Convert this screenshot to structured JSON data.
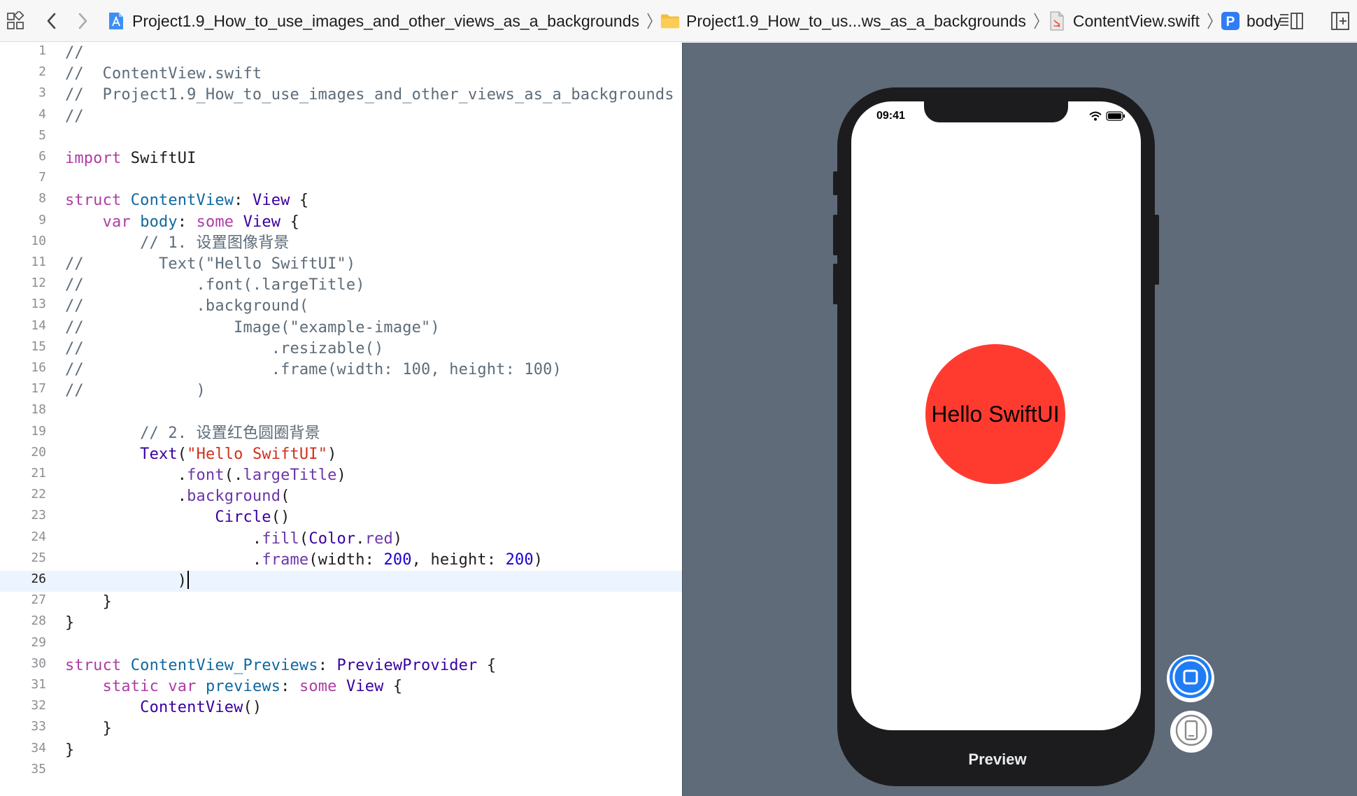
{
  "jumpbar": {
    "grid_icon": "related-items-grid-icon",
    "back_icon": "chevron-left-icon",
    "forward_icon": "chevron-right-icon",
    "crumbs": [
      {
        "label": "Project1.9_How_to_use_images_and_other_views_as_a_backgrounds",
        "icon": "xcode-project-icon"
      },
      {
        "label": "Project1.9_How_to_us...ws_as_a_backgrounds",
        "icon": "folder-icon"
      },
      {
        "label": "ContentView.swift",
        "icon": "swift-file-icon"
      },
      {
        "label": "body",
        "icon": "property-p-icon",
        "icon_letter": "P"
      }
    ],
    "editor_options_icon": "editor-options-icon",
    "add_editor_icon": "add-editor-split-icon"
  },
  "editor": {
    "current_line": 26,
    "lines": [
      {
        "n": "1",
        "tokens": [
          {
            "t": "//",
            "c": "com"
          }
        ]
      },
      {
        "n": "2",
        "tokens": [
          {
            "t": "//  ContentView.swift",
            "c": "com"
          }
        ]
      },
      {
        "n": "3",
        "tokens": [
          {
            "t": "//  Project1.9_How_to_use_images_and_other_views_as_a_backgrounds",
            "c": "com"
          }
        ]
      },
      {
        "n": "4",
        "tokens": [
          {
            "t": "//",
            "c": "com"
          }
        ]
      },
      {
        "n": "5",
        "tokens": []
      },
      {
        "n": "6",
        "tokens": [
          {
            "t": "import",
            "c": "kw"
          },
          {
            "t": " SwiftUI",
            "c": "plain"
          }
        ]
      },
      {
        "n": "7",
        "tokens": []
      },
      {
        "n": "8",
        "tokens": [
          {
            "t": "struct",
            "c": "kw"
          },
          {
            "t": " ",
            "c": "plain"
          },
          {
            "t": "ContentView",
            "c": "decl"
          },
          {
            "t": ": ",
            "c": "plain"
          },
          {
            "t": "View",
            "c": "type"
          },
          {
            "t": " {",
            "c": "plain"
          }
        ]
      },
      {
        "n": "9",
        "tokens": [
          {
            "t": "    ",
            "c": "plain"
          },
          {
            "t": "var",
            "c": "kw"
          },
          {
            "t": " ",
            "c": "plain"
          },
          {
            "t": "body",
            "c": "decl"
          },
          {
            "t": ": ",
            "c": "plain"
          },
          {
            "t": "some",
            "c": "kw"
          },
          {
            "t": " ",
            "c": "plain"
          },
          {
            "t": "View",
            "c": "type"
          },
          {
            "t": " {",
            "c": "plain"
          }
        ]
      },
      {
        "n": "10",
        "tokens": [
          {
            "t": "        // 1. 设置图像背景",
            "c": "com"
          }
        ]
      },
      {
        "n": "11",
        "tokens": [
          {
            "t": "//        Text(\"Hello SwiftUI\")",
            "c": "com"
          }
        ]
      },
      {
        "n": "12",
        "tokens": [
          {
            "t": "//            .font(.largeTitle)",
            "c": "com"
          }
        ]
      },
      {
        "n": "13",
        "tokens": [
          {
            "t": "//            .background(",
            "c": "com"
          }
        ]
      },
      {
        "n": "14",
        "tokens": [
          {
            "t": "//                Image(\"example-image\")",
            "c": "com"
          }
        ]
      },
      {
        "n": "15",
        "tokens": [
          {
            "t": "//                    .resizable()",
            "c": "com"
          }
        ]
      },
      {
        "n": "16",
        "tokens": [
          {
            "t": "//                    .frame(width: 100, height: 100)",
            "c": "com"
          }
        ]
      },
      {
        "n": "17",
        "tokens": [
          {
            "t": "//            )",
            "c": "com"
          }
        ]
      },
      {
        "n": "18",
        "tokens": []
      },
      {
        "n": "19",
        "tokens": [
          {
            "t": "        // 2. 设置红色圆圈背景",
            "c": "com"
          }
        ]
      },
      {
        "n": "20",
        "tokens": [
          {
            "t": "        ",
            "c": "plain"
          },
          {
            "t": "Text",
            "c": "type"
          },
          {
            "t": "(",
            "c": "plain"
          },
          {
            "t": "\"Hello SwiftUI\"",
            "c": "str"
          },
          {
            "t": ")",
            "c": "plain"
          }
        ]
      },
      {
        "n": "21",
        "tokens": [
          {
            "t": "            .",
            "c": "plain"
          },
          {
            "t": "font",
            "c": "mem"
          },
          {
            "t": "(.",
            "c": "plain"
          },
          {
            "t": "largeTitle",
            "c": "mem"
          },
          {
            "t": ")",
            "c": "plain"
          }
        ]
      },
      {
        "n": "22",
        "tokens": [
          {
            "t": "            .",
            "c": "plain"
          },
          {
            "t": "background",
            "c": "mem"
          },
          {
            "t": "(",
            "c": "plain"
          }
        ]
      },
      {
        "n": "23",
        "tokens": [
          {
            "t": "                ",
            "c": "plain"
          },
          {
            "t": "Circle",
            "c": "type"
          },
          {
            "t": "()",
            "c": "plain"
          }
        ]
      },
      {
        "n": "24",
        "tokens": [
          {
            "t": "                    .",
            "c": "plain"
          },
          {
            "t": "fill",
            "c": "mem"
          },
          {
            "t": "(",
            "c": "plain"
          },
          {
            "t": "Color",
            "c": "type"
          },
          {
            "t": ".",
            "c": "plain"
          },
          {
            "t": "red",
            "c": "mem"
          },
          {
            "t": ")",
            "c": "plain"
          }
        ]
      },
      {
        "n": "25",
        "tokens": [
          {
            "t": "                    .",
            "c": "plain"
          },
          {
            "t": "frame",
            "c": "mem"
          },
          {
            "t": "(width: ",
            "c": "plain"
          },
          {
            "t": "200",
            "c": "num"
          },
          {
            "t": ", height: ",
            "c": "plain"
          },
          {
            "t": "200",
            "c": "num"
          },
          {
            "t": ")",
            "c": "plain"
          }
        ]
      },
      {
        "n": "26",
        "tokens": [
          {
            "t": "            )",
            "c": "plain"
          }
        ],
        "caret": true
      },
      {
        "n": "27",
        "tokens": [
          {
            "t": "    }",
            "c": "plain"
          }
        ]
      },
      {
        "n": "28",
        "tokens": [
          {
            "t": "}",
            "c": "plain"
          }
        ]
      },
      {
        "n": "29",
        "tokens": []
      },
      {
        "n": "30",
        "tokens": [
          {
            "t": "struct",
            "c": "kw"
          },
          {
            "t": " ",
            "c": "plain"
          },
          {
            "t": "ContentView_Previews",
            "c": "decl"
          },
          {
            "t": ": ",
            "c": "plain"
          },
          {
            "t": "PreviewProvider",
            "c": "type"
          },
          {
            "t": " {",
            "c": "plain"
          }
        ]
      },
      {
        "n": "31",
        "tokens": [
          {
            "t": "    ",
            "c": "plain"
          },
          {
            "t": "static",
            "c": "kw"
          },
          {
            "t": " ",
            "c": "plain"
          },
          {
            "t": "var",
            "c": "kw"
          },
          {
            "t": " ",
            "c": "plain"
          },
          {
            "t": "previews",
            "c": "decl"
          },
          {
            "t": ": ",
            "c": "plain"
          },
          {
            "t": "some",
            "c": "kw"
          },
          {
            "t": " ",
            "c": "plain"
          },
          {
            "t": "View",
            "c": "type"
          },
          {
            "t": " {",
            "c": "plain"
          }
        ]
      },
      {
        "n": "32",
        "tokens": [
          {
            "t": "        ",
            "c": "plain"
          },
          {
            "t": "ContentView",
            "c": "type"
          },
          {
            "t": "()",
            "c": "plain"
          }
        ]
      },
      {
        "n": "33",
        "tokens": [
          {
            "t": "    }",
            "c": "plain"
          }
        ]
      },
      {
        "n": "34",
        "tokens": [
          {
            "t": "}",
            "c": "plain"
          }
        ]
      },
      {
        "n": "35",
        "tokens": []
      }
    ]
  },
  "preview": {
    "status_time": "09:41",
    "wifi_icon": "wifi-icon",
    "battery_icon": "battery-icon",
    "circle_text": "Hello SwiftUI",
    "circle_color": "#ff3b30",
    "live_preview_icon": "live-preview-icon",
    "device_preview_icon": "device-preview-icon",
    "label": "Preview"
  },
  "colors": {
    "canvas_bg": "#5f6b78",
    "keyword": "#ad3da4",
    "type": "#3900a0",
    "declaration": "#0f68a0",
    "string": "#d12f1b",
    "number": "#1c00cf",
    "comment": "#5d6c79",
    "member": "#6c36a9",
    "accent": "#1f7cf5"
  }
}
